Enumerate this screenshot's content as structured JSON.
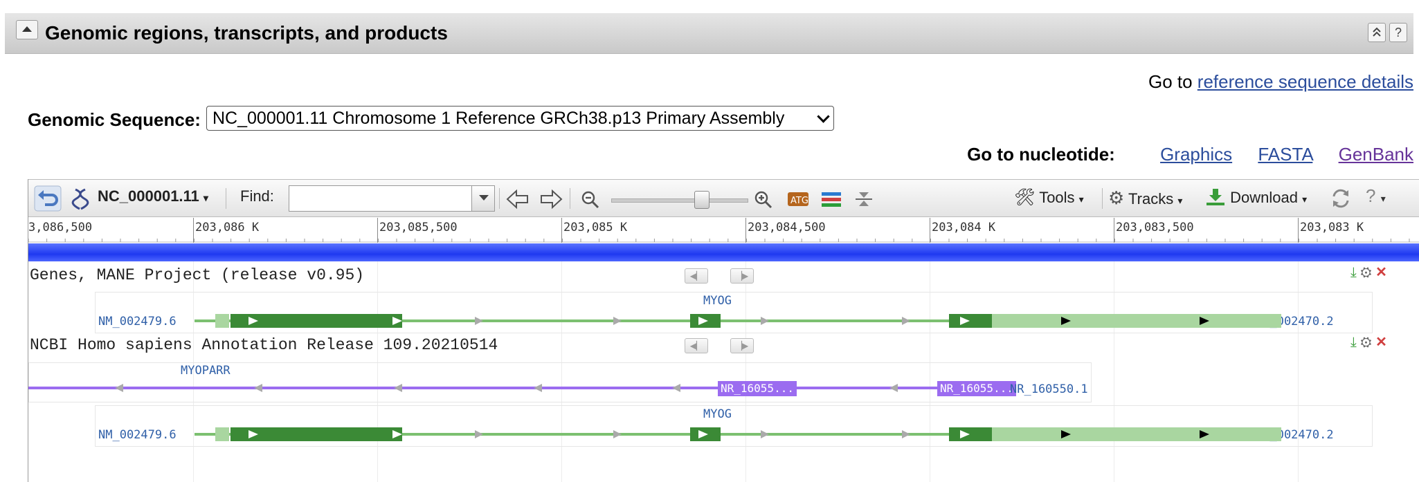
{
  "header": {
    "title": "Genomic regions, transcripts, and products",
    "collapse_icon": "triangle-up-icon",
    "buttons": [
      "double-chevron-up-icon",
      "help-icon"
    ],
    "help_label": "?"
  },
  "goto_ref": {
    "prefix": "Go to",
    "link": "reference sequence details"
  },
  "genomic_sequence": {
    "label": "Genomic Sequence:",
    "selected": "NC_000001.11 Chromosome 1 Reference GRCh38.p13 Primary Assembly"
  },
  "goto_nucleotide": {
    "label": "Go to nucleotide:",
    "links": [
      "Graphics",
      "FASTA",
      "GenBank"
    ]
  },
  "toolbar": {
    "accession": "NC_000001.11",
    "find_label": "Find:",
    "find_value": "",
    "tools": "Tools",
    "tracks": "Tracks",
    "download": "Download",
    "help": "?"
  },
  "ruler": {
    "labels": [
      "3,086,500",
      "203,086 K",
      "203,085,500",
      "203,085 K",
      "203,084,500",
      "203,084 K",
      "203,083,500",
      "203,083 K"
    ]
  },
  "tracks": [
    {
      "title": "Genes, MANE Project (release v0.95)",
      "gene": "MYOG",
      "transcript": "NM_002479.6",
      "product": "NP_002470.2"
    },
    {
      "title": "NCBI Homo sapiens Annotation Release 109.20210514",
      "lncrna_gene": "MYOPARR",
      "rna_tag_1": "NR_16055...",
      "rna_tag_2": "NR_16055...",
      "rna_full": "NR_160550.1",
      "gene": "MYOG",
      "transcript": "NM_002479.6",
      "product": "NP_002470.2"
    }
  ],
  "colors": {
    "exon_dark": "#3b8a36",
    "exon_light": "#a9d6a0",
    "intron": "#7cc070",
    "ncrna": "#9b6cf0",
    "chromosome_bar": "#2a44f5",
    "link": "#2b4d9c"
  }
}
